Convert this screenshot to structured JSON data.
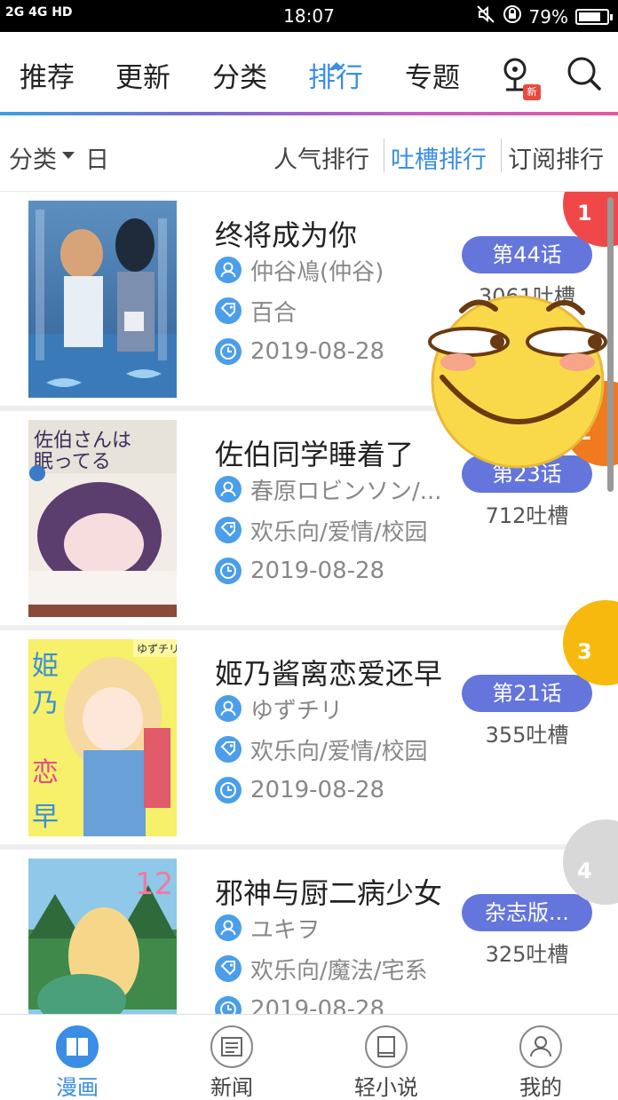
{
  "status": {
    "signal": "2G 4G HD",
    "time": "18:07",
    "battery": "79%",
    "battery_level": 0.79
  },
  "nav": {
    "tabs": [
      {
        "label": "推荐"
      },
      {
        "label": "更新"
      },
      {
        "label": "分类"
      },
      {
        "label": "排行",
        "active": true
      },
      {
        "label": "专题"
      }
    ],
    "new_badge": "新"
  },
  "filter": {
    "category": "分类",
    "period": "日",
    "sorts": [
      "人气排行",
      "吐槽排行",
      "订阅排行"
    ],
    "active_sort": "吐槽排行"
  },
  "list": [
    {
      "rank": "1",
      "rank_color": "#f04848",
      "title": "终将成为你",
      "author": "仲谷鳰(仲谷)",
      "tags": "百合",
      "date": "2019-08-28",
      "chapter": "第44话",
      "comments": "3061吐槽"
    },
    {
      "rank": "2",
      "rank_color": "#f07a1e",
      "title": "佐伯同学睡着了",
      "author": "春原ロビンソン/...",
      "tags": "欢乐向/爱情/校园",
      "date": "2019-08-28",
      "chapter": "第23话",
      "comments": "712吐槽"
    },
    {
      "rank": "3",
      "rank_color": "#f7b90e",
      "title": "姬乃酱离恋爱还早",
      "author": "ゆずチリ",
      "tags": "欢乐向/爱情/校园",
      "date": "2019-08-28",
      "chapter": "第21话",
      "comments": "355吐槽"
    },
    {
      "rank": "4",
      "rank_color": "#d8d8d8",
      "title": "邪神与厨二病少女",
      "author": "ユキヲ",
      "tags": "欢乐向/魔法/宅系",
      "date": "2019-08-28",
      "chapter": "杂志版...",
      "comments": "325吐槽"
    }
  ],
  "bottom_nav": [
    {
      "label": "漫画",
      "active": true
    },
    {
      "label": "新闻"
    },
    {
      "label": "轻小说"
    },
    {
      "label": "我的"
    }
  ]
}
